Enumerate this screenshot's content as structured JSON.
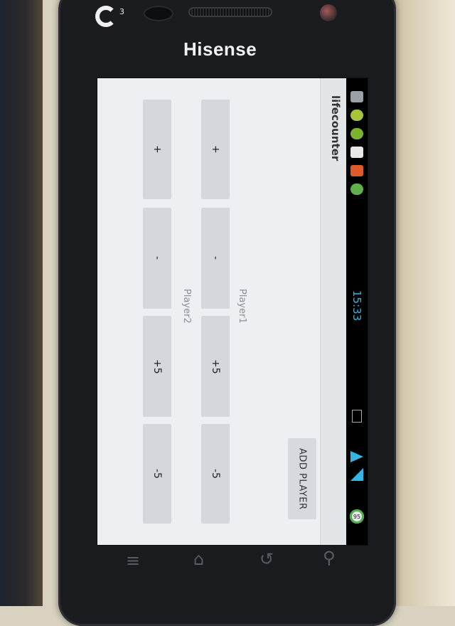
{
  "device": {
    "brand": "Hisense",
    "carrier_logo": "G",
    "carrier_sup": "3"
  },
  "status_bar": {
    "time": "15:33",
    "battery": "95",
    "icons": [
      "usb-icon",
      "android-icon",
      "wechat-icon",
      "mail-icon",
      "app-icon",
      "green-app-icon",
      "rotate-icon",
      "wifi-icon",
      "signal-icon",
      "battery-icon"
    ],
    "time_color": "#33b5e5"
  },
  "app": {
    "title": "lifecounter",
    "add_player_label": "ADD PLAYER",
    "players": [
      {
        "name": "Player1",
        "buttons": [
          "+",
          "-",
          "+5",
          "-5"
        ]
      },
      {
        "name": "Player2",
        "buttons": [
          "+",
          "-",
          "+5",
          "-5"
        ]
      }
    ]
  },
  "nav_keys": [
    "menu-icon",
    "home-icon",
    "back-icon",
    "search-icon"
  ]
}
